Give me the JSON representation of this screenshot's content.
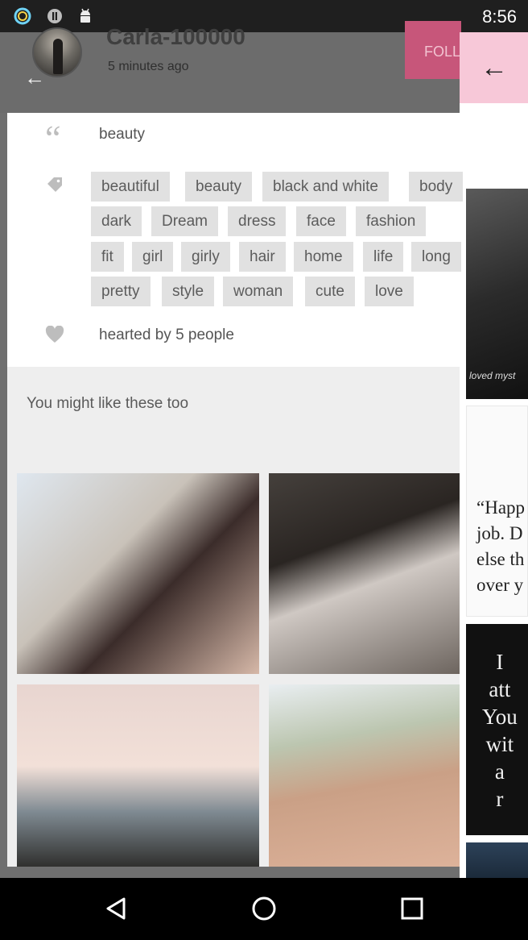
{
  "status_bar": {
    "time": "8:56",
    "icons": [
      "circle-app-icon",
      "block-icon",
      "android-icon"
    ]
  },
  "post": {
    "username": "Carla-100000",
    "time_ago": "5 minutes ago",
    "follow_label": "FOLLOW",
    "description": "beauty",
    "tags": [
      "beautiful",
      "beauty",
      "black and white",
      "body",
      "dark",
      "Dream",
      "dress",
      "face",
      "fashion",
      "fit",
      "girl",
      "girly",
      "hair",
      "home",
      "life",
      "long",
      "pretty",
      "style",
      "woman",
      "cute",
      "love"
    ],
    "hearted_text": "hearted by 5 people"
  },
  "suggestions": {
    "title": "You might like these too"
  },
  "right_strip": {
    "thumb1_caption": "loved myst",
    "thumb2_quote": "“Happ\njob. D\nelse th\nover y",
    "thumb3_quote": "I\natt\nYou\nwit\na\nr"
  },
  "colors": {
    "accent_pink": "#f7c8d8",
    "follow_button": "#c7567a"
  }
}
